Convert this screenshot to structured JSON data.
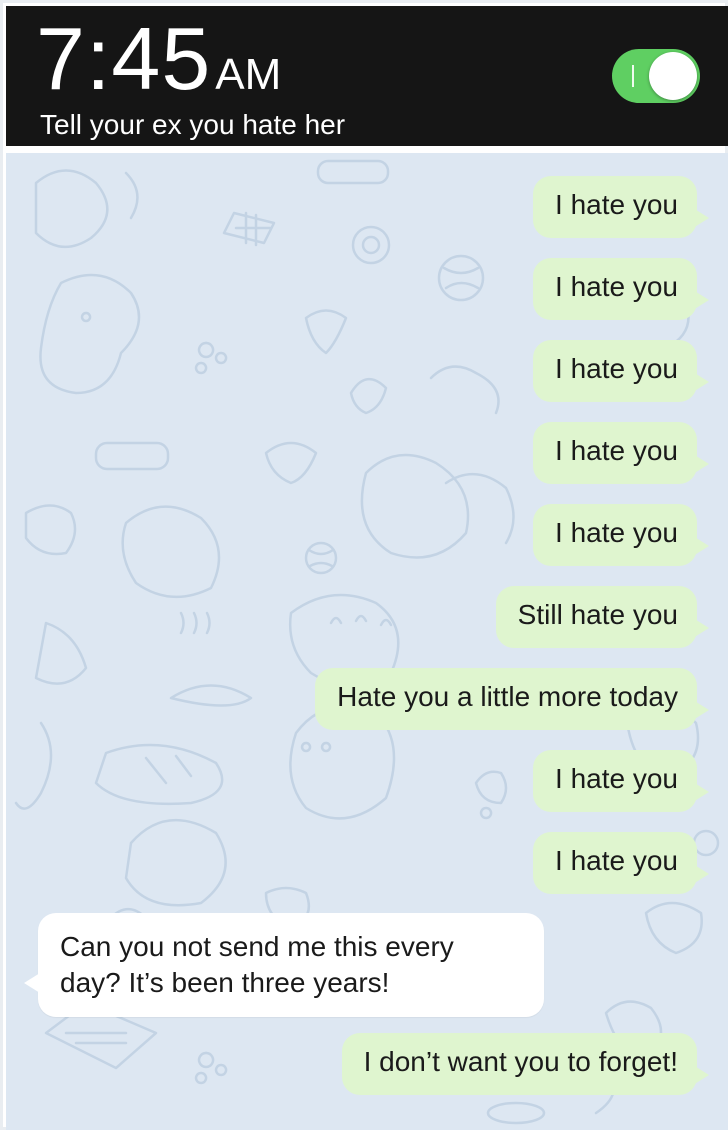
{
  "alarm": {
    "time": "7:45",
    "ampm": "AM",
    "label": "Tell your ex you hate her",
    "toggle_on": true
  },
  "messages": [
    {
      "from": "me",
      "text": "I hate you"
    },
    {
      "from": "me",
      "text": "I hate you"
    },
    {
      "from": "me",
      "text": "I hate you"
    },
    {
      "from": "me",
      "text": "I hate you"
    },
    {
      "from": "me",
      "text": "I hate you"
    },
    {
      "from": "me",
      "text": "Still hate you"
    },
    {
      "from": "me",
      "text": "Hate you a little more today"
    },
    {
      "from": "me",
      "text": "I hate you"
    },
    {
      "from": "me",
      "text": "I hate you"
    },
    {
      "from": "them",
      "text": "Can you not send me this every day? It’s been three years!"
    },
    {
      "from": "me",
      "text": "I don’t want you to forget!"
    }
  ],
  "colors": {
    "header_bg": "#151515",
    "toggle_on": "#5fcf62",
    "chat_bg": "#dde7f2",
    "outgoing_bubble": "#dff5cf",
    "incoming_bubble": "#ffffff"
  },
  "icons": [
    "toggle-switch",
    "chat-wallpaper-doodles"
  ]
}
